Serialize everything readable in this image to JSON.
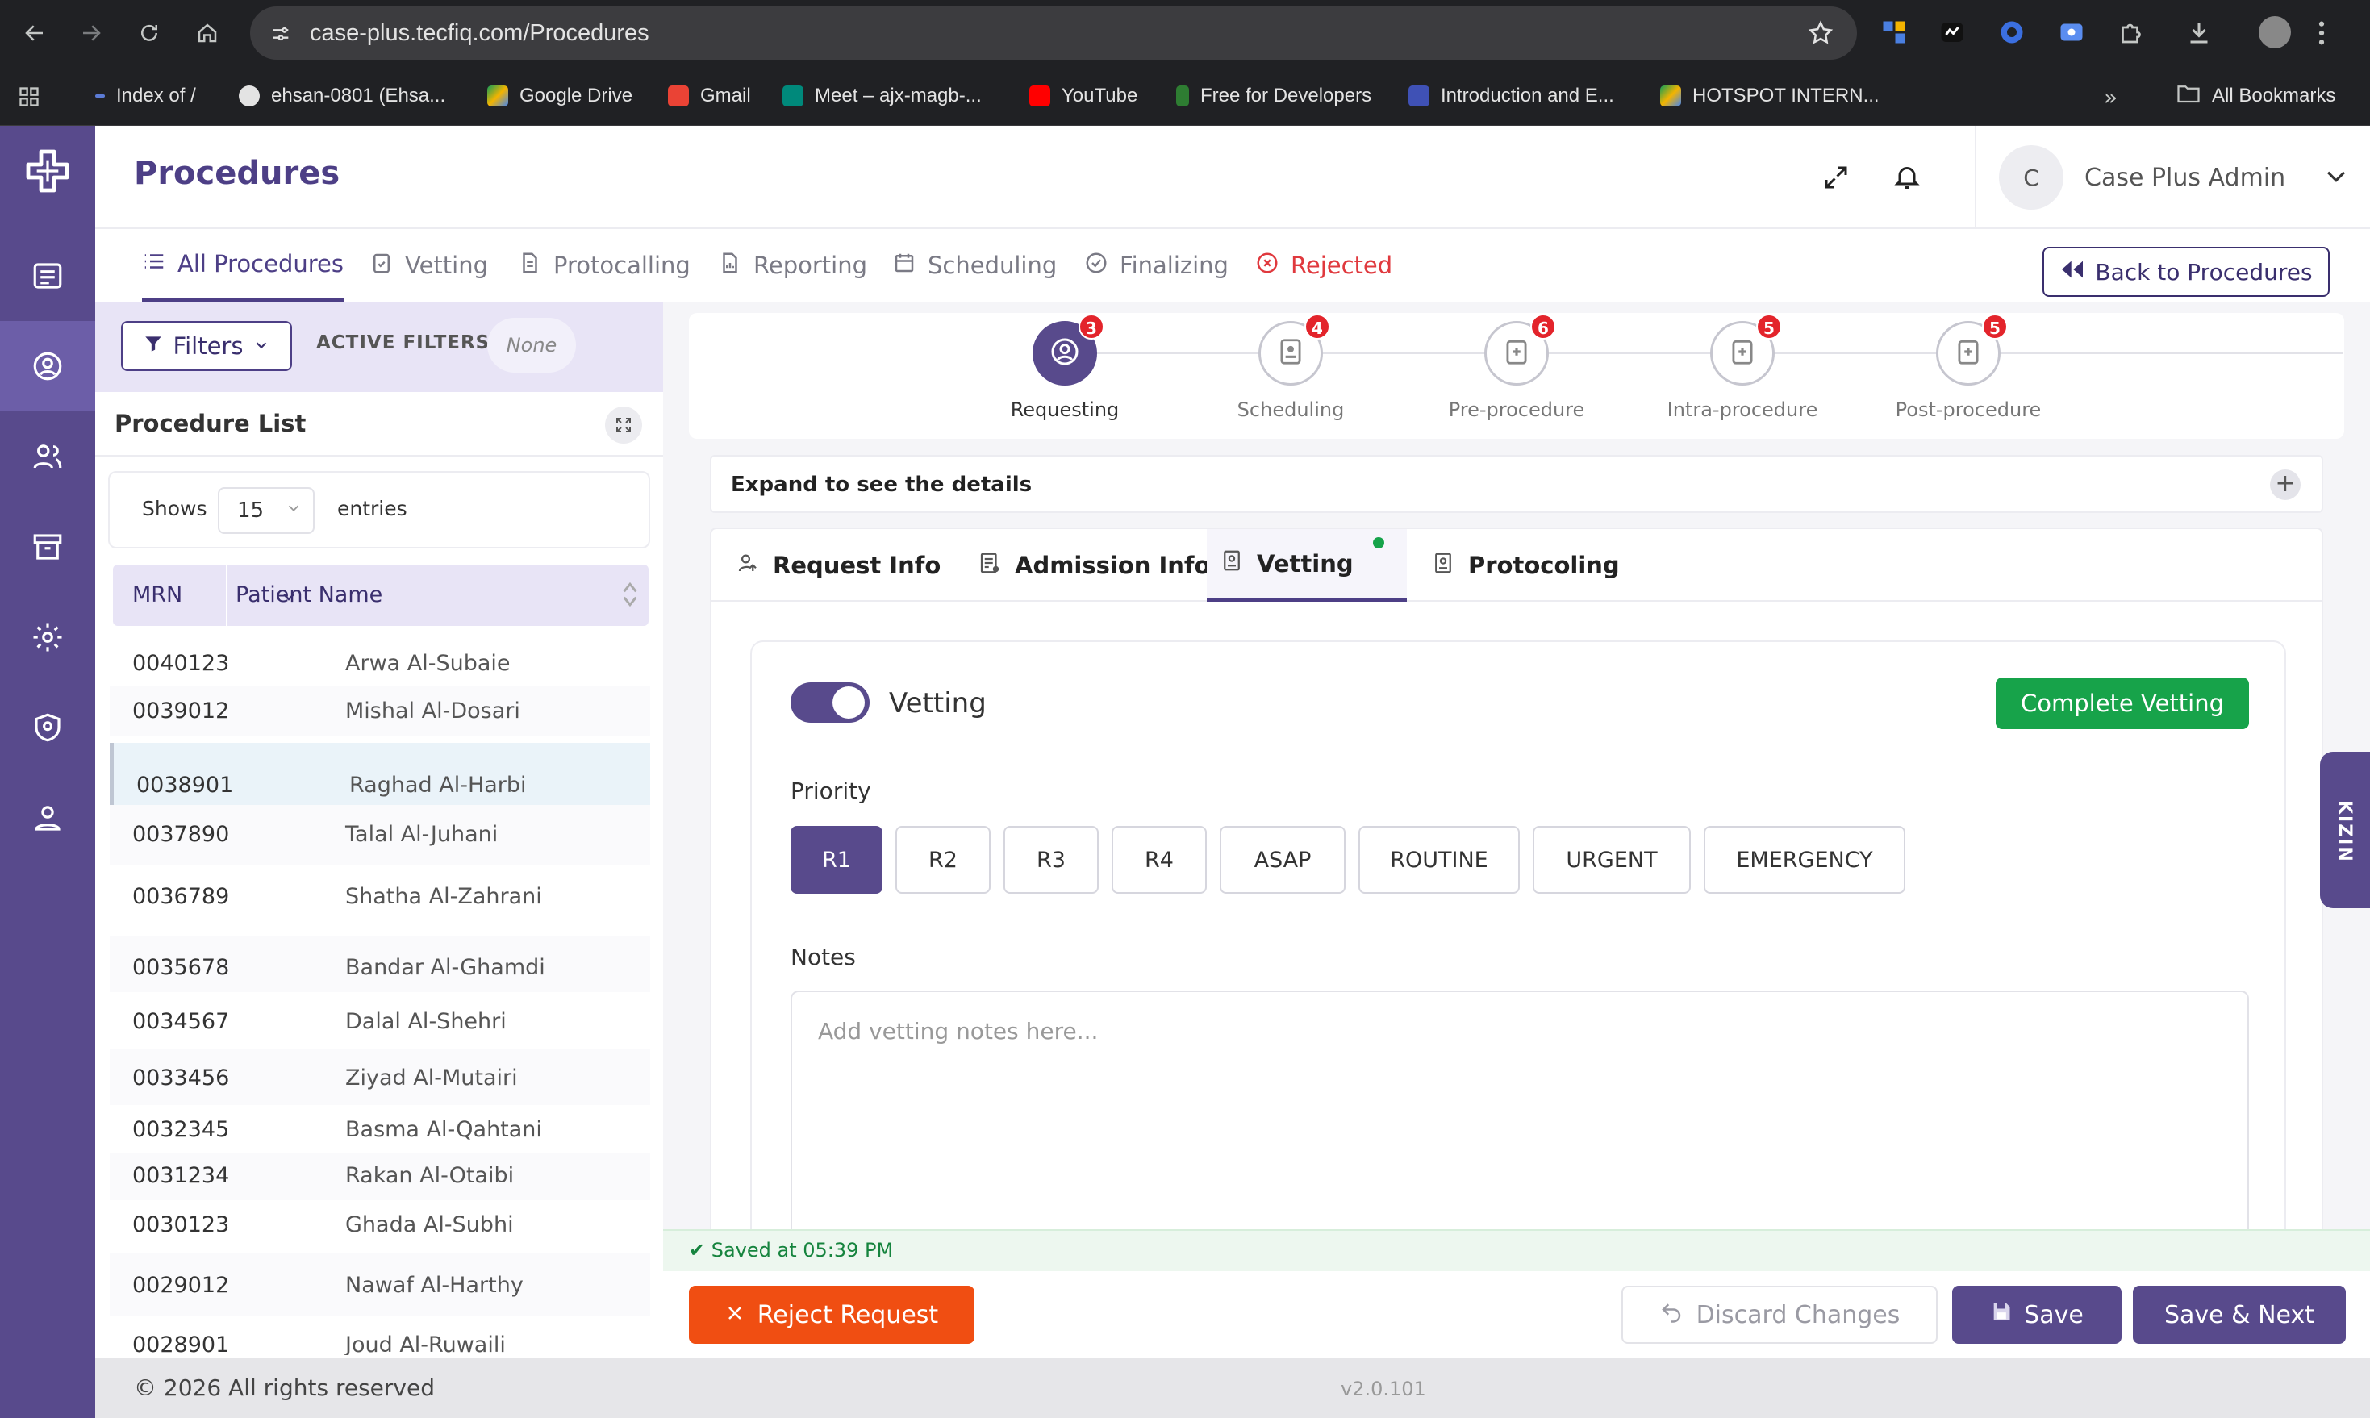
{
  "browser": {
    "url": "case-plus.tecfiq.com/Procedures",
    "bookmarks": [
      {
        "label": "Index of /",
        "color": "#5b7bd5"
      },
      {
        "label": "ehsan-0801 (Ehsa...",
        "color": "#e3e3e3"
      },
      {
        "label": "Google Drive",
        "color": "#f4b400"
      },
      {
        "label": "Gmail",
        "color": "#ea4335"
      },
      {
        "label": "Meet – ajx-magb-...",
        "color": "#00897b"
      },
      {
        "label": "YouTube",
        "color": "#ff0000"
      },
      {
        "label": "Free for Developers",
        "color": "#2e7d32"
      },
      {
        "label": "Introduction and E...",
        "color": "#3f51b5"
      },
      {
        "label": "HOTSPOT INTERN...",
        "color": "#f4b400"
      }
    ],
    "all_bookmarks": "All Bookmarks"
  },
  "header": {
    "title": "Procedures",
    "avatar_initial": "C",
    "user_name": "Case Plus Admin"
  },
  "tabs": [
    {
      "label": "All Procedures"
    },
    {
      "label": "Vetting"
    },
    {
      "label": "Protocalling"
    },
    {
      "label": "Reporting"
    },
    {
      "label": "Scheduling"
    },
    {
      "label": "Finalizing"
    },
    {
      "label": "Rejected"
    }
  ],
  "back_button": "Back to Procedures",
  "filters": {
    "button": "Filters",
    "active_label": "ACTIVE FILTERS:",
    "active_value": "None"
  },
  "procedure_list": {
    "title": "Procedure List",
    "shows": "Shows",
    "entries_value": "15",
    "entries": "entries",
    "columns": [
      "MRN",
      "Patient Name"
    ],
    "rows": [
      {
        "mrn": "0040123",
        "name": "Arwa Al-Subaie"
      },
      {
        "mrn": "0039012",
        "name": "Mishal Al-Dosari"
      },
      {
        "mrn": "0038901",
        "name": "Raghad Al-Harbi"
      },
      {
        "mrn": "0037890",
        "name": "Talal Al-Juhani"
      },
      {
        "mrn": "0036789",
        "name": "Shatha Al-Zahrani"
      },
      {
        "mrn": "0035678",
        "name": "Bandar Al-Ghamdi"
      },
      {
        "mrn": "0034567",
        "name": "Dalal Al-Shehri"
      },
      {
        "mrn": "0033456",
        "name": "Ziyad Al-Mutairi"
      },
      {
        "mrn": "0032345",
        "name": "Basma Al-Qahtani"
      },
      {
        "mrn": "0031234",
        "name": "Rakan Al-Otaibi"
      },
      {
        "mrn": "0030123",
        "name": "Ghada Al-Subhi"
      },
      {
        "mrn": "0029012",
        "name": "Nawaf Al-Harthy"
      },
      {
        "mrn": "0028901",
        "name": "Joud Al-Ruwaili"
      }
    ]
  },
  "stepper": [
    {
      "label": "Requesting",
      "badge": "3"
    },
    {
      "label": "Scheduling",
      "badge": "4"
    },
    {
      "label": "Pre-procedure",
      "badge": "6"
    },
    {
      "label": "Intra-procedure",
      "badge": "5"
    },
    {
      "label": "Post-procedure",
      "badge": "5"
    }
  ],
  "expand_text": "Expand to see the details",
  "sub_tabs": [
    {
      "label": "Request Info"
    },
    {
      "label": "Admission Info"
    },
    {
      "label": "Vetting"
    },
    {
      "label": "Protocoling"
    }
  ],
  "vetting": {
    "label": "Vetting",
    "enabled": true,
    "complete_button": "Complete Vetting",
    "priority_label": "Priority",
    "priorities": [
      "R1",
      "R2",
      "R3",
      "R4",
      "ASAP",
      "ROUTINE",
      "URGENT",
      "EMERGENCY"
    ],
    "selected_priority": "R1",
    "notes_label": "Notes",
    "notes_placeholder": "Add vetting notes here...",
    "notes_value": ""
  },
  "side_tab": "KIZIN",
  "saved_status": "✔ Saved at 05:39 PM",
  "actions": {
    "reject": "Reject Request",
    "discard": "Discard Changes",
    "save": "Save",
    "save_next": "Save & Next"
  },
  "footer": {
    "copyright": "© 2026 All rights reserved",
    "version": "v2.0.101"
  }
}
